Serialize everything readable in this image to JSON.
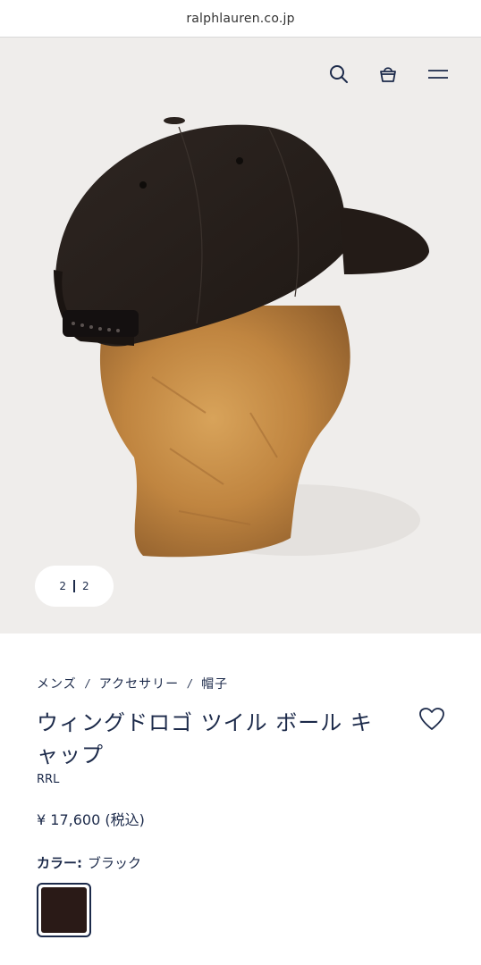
{
  "browser": {
    "url": "ralphlauren.co.jp"
  },
  "header": {
    "icons": [
      "search-icon",
      "bag-icon",
      "menu-icon"
    ]
  },
  "gallery": {
    "current": "2",
    "total": "2"
  },
  "breadcrumb": [
    "メンズ",
    "アクセサリー",
    "帽子"
  ],
  "breadcrumb_separator": "/",
  "product": {
    "title": "ウィングドロゴ ツイル ボール キャップ",
    "brand": "RRL",
    "price": "¥ 17,600 (税込)"
  },
  "color": {
    "label": "カラー:",
    "value": "ブラック",
    "swatch_color": "#2a1a17"
  },
  "colors": {
    "accent": "#1c2a4a",
    "hero_bg": "#efedeb"
  }
}
